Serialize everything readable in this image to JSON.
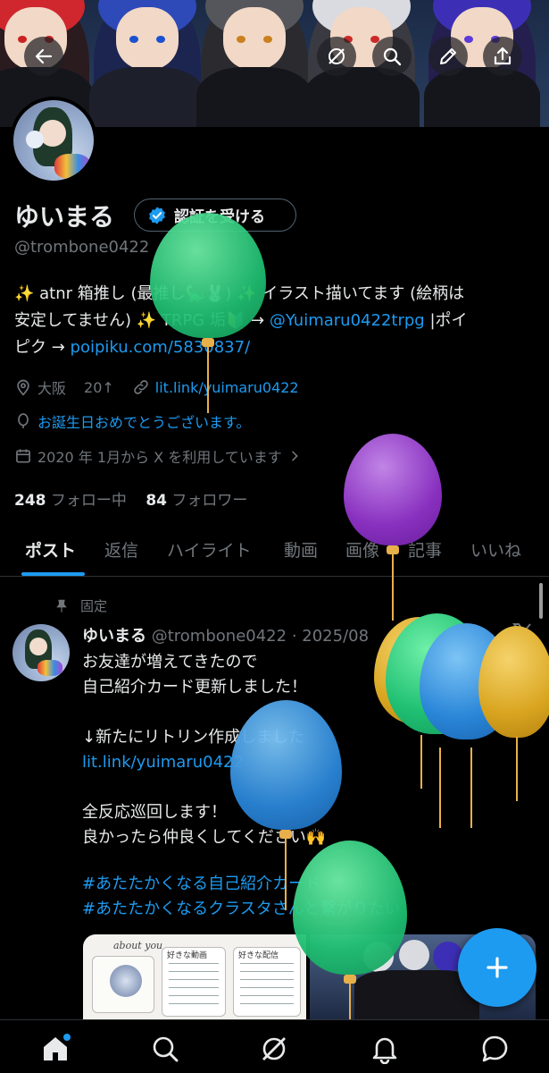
{
  "header": {
    "back": "back-arrow-icon",
    "actions": [
      "grok-icon",
      "search-icon",
      "edit-icon",
      "share-icon"
    ]
  },
  "profile": {
    "name": "ゆいまる",
    "verify_label": "認証を受ける",
    "handle": "@trombone0422",
    "bio_line1_a": "✨ atnr 箱推し (最推し🦕🐰) ✨ イラスト描いてます (絵柄は",
    "bio_line2_a": "安定してません) ✨ TRPG 垢🔰 → ",
    "bio_mention": "@Yuimaru0422trpg",
    "bio_line2_b": " |ポイ",
    "bio_line3_a": "ピク → ",
    "bio_link": "poipiku.com/5830837/",
    "location": "大阪",
    "age": "20↑",
    "link": "lit.link/yuimaru0422",
    "birthday": "お誕生日おめでとうございます。",
    "joined": "2020 年 1月から X を利用しています",
    "following_count": "248",
    "following_label": "フォロー中",
    "followers_count": "84",
    "followers_label": "フォロワー"
  },
  "tabs": [
    "ポスト",
    "返信",
    "ハイライト",
    "動画",
    "画像",
    "記事",
    "いいね"
  ],
  "post": {
    "pinned_label": "固定",
    "author": "ゆいまる",
    "handle": "@trombone0422",
    "sep": "·",
    "date": "2025/08",
    "line1": "お友達が増えてきたので",
    "line2": "自己紹介カード更新しました！",
    "line3": "↓新たにリトリン作成しました",
    "link": "lit.link/yuimaru0422",
    "line4": "全反応巡回します！",
    "line5": "良かったら仲良くしてください🙌",
    "tag1": "#あたたかくなる自己紹介カード",
    "tag2": "#あたたかくなるクラスタさんと繋がりたい",
    "card_title": "about you",
    "card_header1": "好きな動画",
    "card_header2": "好きな配信"
  },
  "nav": [
    "home-icon",
    "search-icon",
    "grok-icon",
    "notifications-icon",
    "messages-icon"
  ],
  "colors": {
    "accent": "#1d9bf0",
    "background": "#000000",
    "text": "#e7e9ea",
    "muted": "#71767b"
  }
}
